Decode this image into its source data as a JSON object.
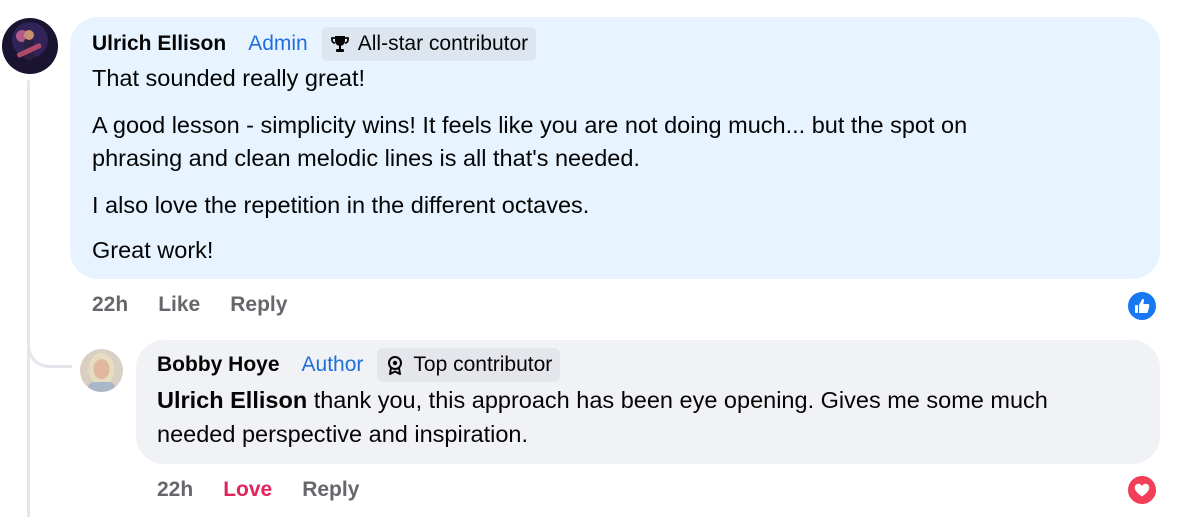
{
  "comments": [
    {
      "author": "Ulrich Ellison",
      "role": "Admin",
      "badge": "All-star contributor",
      "badge_icon": "trophy-icon",
      "paragraphs": [
        "That sounded really great!",
        "A good lesson - simplicity wins! It feels like you are not doing much... but the spot on",
        "phrasing and clean melodic lines is all that's needed.",
        "I also love the repetition in the different octaves.",
        "Great work!"
      ],
      "time": "22h",
      "action_1": "Like",
      "action_2": "Reply",
      "reaction_icon": "like-icon"
    },
    {
      "author": "Bobby Hoye",
      "role": "Author",
      "badge": "Top contributor",
      "badge_icon": "rosette-icon",
      "mention": "Ulrich Ellison",
      "line_1": " thank you, this approach has been eye opening. Gives me some much",
      "line_2": "needed perspective and inspiration.",
      "time": "22h",
      "action_1": "Love",
      "action_2": "Reply",
      "reaction_icon": "heart-icon"
    }
  ],
  "colors": {
    "bubble_1": "#e7f3ff",
    "bubble_2": "#f0f2f5",
    "role_blue": "#216fdb",
    "love_red": "#e0245e",
    "like_blue": "#1877f2"
  }
}
